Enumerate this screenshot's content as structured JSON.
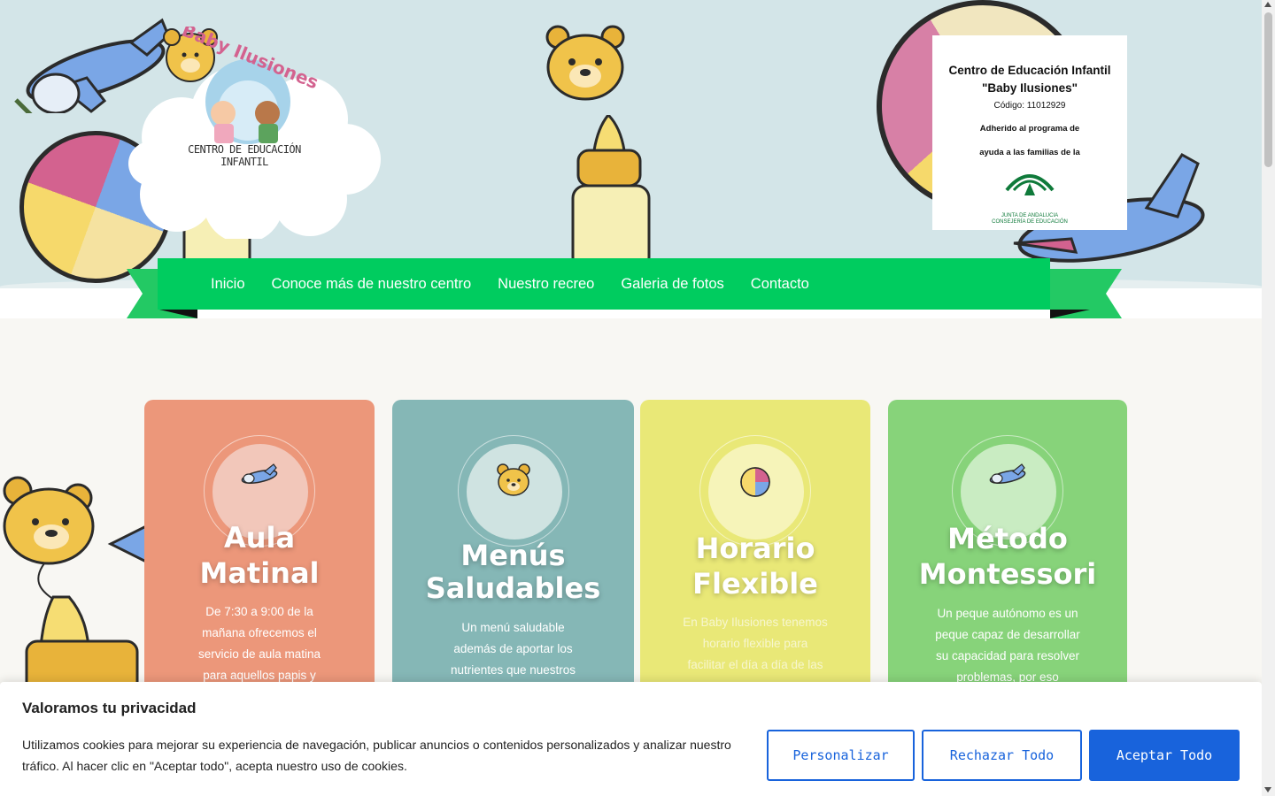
{
  "header": {
    "logo": {
      "brand": "Baby Ilusiones",
      "caption": "CENTRO DE EDUCACIÓN INFANTIL"
    },
    "badge": {
      "title_line1": "Centro de Educación Infantil",
      "title_line2": "\"Baby Ilusiones\"",
      "code": "Código: 11012929",
      "text_line1": "Adherido al programa de",
      "text_line2": "ayuda a las familias de la",
      "logo_label1": "JUNTA DE ANDALUCIA",
      "logo_label2": "CONSEJERÍA DE EDUCACIÓN"
    }
  },
  "nav": {
    "items": [
      {
        "label": "Inicio"
      },
      {
        "label": "Conoce más de nuestro centro"
      },
      {
        "label": "Nuestro recreo"
      },
      {
        "label": "Galeria de fotos"
      },
      {
        "label": "Contacto"
      }
    ]
  },
  "cards": [
    {
      "title_line1": "Aula",
      "title_line2": "Matinal",
      "text": "De 7:30 a 9:00 de la mañana ofrecemos el servicio de aula matina para aquellos papis y",
      "icon": "airplane-icon",
      "color": "#ec977a"
    },
    {
      "title_line1": "Menús",
      "title_line2": "Saludables",
      "text": "Un menú saludable además de aportar los nutrientes que nuestros peques necesitan",
      "icon": "teddy-bear-icon",
      "color": "#85b7b6"
    },
    {
      "title_line1": "Horario",
      "title_line2": "Flexible",
      "text": "En Baby Ilusiones tenemos horario flexible para facilitar el día a día de las",
      "icon": "beach-ball-icon",
      "color": "#e9e877"
    },
    {
      "title_line1": "Método",
      "title_line2": "Montessori",
      "text": "Un peque autónomo es un peque capaz de desarrollar su capacidad para resolver problemas, por eso nosotros",
      "icon": "airplane-icon",
      "color": "#87d37a"
    }
  ],
  "cookie_banner": {
    "title": "Valoramos tu privacidad",
    "text": "Utilizamos cookies para mejorar su experiencia de navegación, publicar anuncios o contenidos personalizados y analizar nuestro tráfico. Al hacer clic en \"Aceptar todo\", acepta nuestro uso de cookies.",
    "customize_label": "Personalizar",
    "reject_label": "Rechazar Todo",
    "accept_label": "Aceptar Todo",
    "accent_color": "#1863dc"
  },
  "colors": {
    "nav_green": "#00cc5f",
    "sky": "#d3e5e8"
  }
}
